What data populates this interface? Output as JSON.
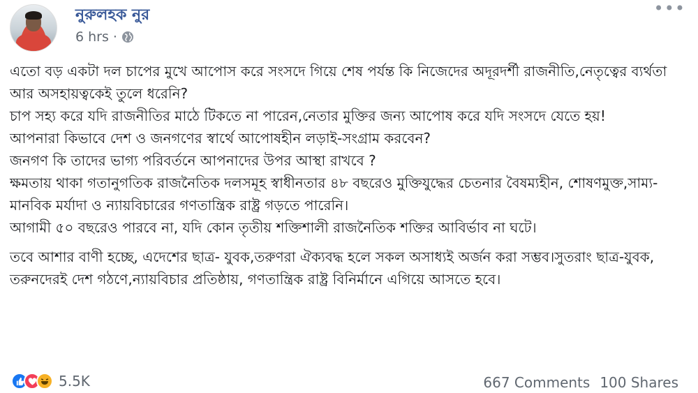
{
  "post": {
    "author": "নুরুলহক নুর",
    "time": "6 hrs",
    "separator": "·",
    "more_label": "•••",
    "paragraphs": [
      "এতো বড় একটা দল চাপের মুখে আপোস করে সংসদে গিয়ে শেষ পর্যন্ত কি নিজেদের অদূরদর্শী রাজনীতি,নেতৃত্বের ব্যর্থতা আর অসহায়ত্বকেই তুলে ধরেনি?",
      "চাপ সহ্য করে যদি রাজনীতির মাঠে টিকতে না পারেন,নেতার মুক্তির জন্য আপোষ করে যদি সংসদে যেতে হয়!",
      "আপনারা কিভাবে দেশ ও জনগণের স্বার্থে আপোষহীন লড়াই-সংগ্রাম করবেন?",
      "জনগণ কি তাদের ভাগ্য পরিবর্তনে আপনাদের উপর আস্থা রাখবে ?",
      "ক্ষমতায় থাকা গতানুগতিক রাজনৈতিক দলসমূহ স্বাধীনতার ৪৮ বছরেও মুক্তিযুদ্ধের চেতনার বৈষম্যহীন, শোষণমুক্ত,সাম্য-মানবিক মর্যাদা ও ন্যায়বিচারের গণতান্ত্রিক রাষ্ট্র গড়তে পারেনি।",
      "আগামী ৫০ বছরেও পারবে না, যদি কোন তৃতীয় শক্তিশালী রাজনৈতিক শক্তির আবির্ভাব না ঘটে।",
      "তবে আশার বাণী হচ্ছে, এদেশের ছাত্র- যুবক,তরুণরা ঐক্যবদ্ধ হলে সকল অসাধ্যই অর্জন করা সম্ভব।সুতরাং ছাত্র-যুবক, তরুনদেরই দেশ গঠণে,ন্যায়বিচার প্রতিষ্ঠায়, গণতান্ত্রিক রাষ্ট্র বিনির্মানে এগিয়ে আসতে হবে।"
    ]
  },
  "footer": {
    "reactions_count": "5.5K",
    "comments": "667 Comments",
    "shares": "100 Shares"
  },
  "icons": {
    "audience": "globe-icon",
    "like": "like-icon",
    "love": "love-icon",
    "haha": "haha-icon",
    "more": "more-icon"
  },
  "colors": {
    "author": "#385898",
    "meta": "#606770",
    "like": "#1877f2",
    "love": "#f33e58",
    "haha": "#f7b125"
  }
}
